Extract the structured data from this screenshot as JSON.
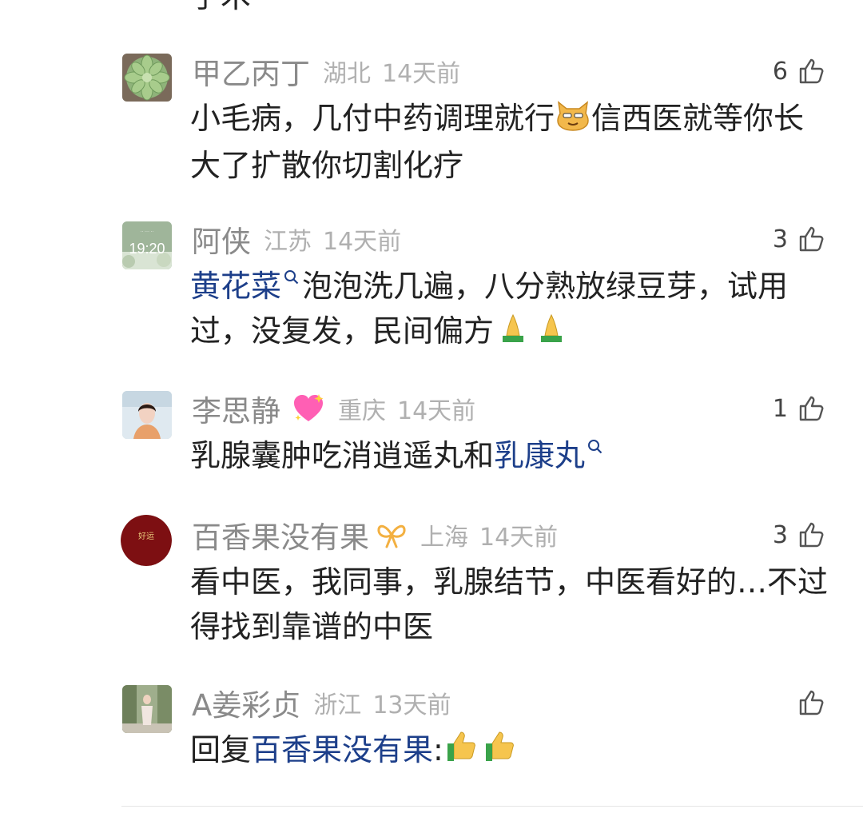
{
  "previous_tail": "手术",
  "comments": [
    {
      "name": "甲乙丙丁",
      "location": "湖北",
      "time": "14天前",
      "likes": "6",
      "text_parts": [
        "小毛病，几付中药调理就行",
        "信西医就等你长大了扩散你切割化疗"
      ],
      "emoji": "cat-emoji"
    },
    {
      "name": "阿侠",
      "location": "江苏",
      "time": "14天前",
      "likes": "3",
      "avatar_time": "19:20",
      "link": "黄花菜",
      "text_after_link": "泡泡洗几遍，八分熟放绿豆芽，试用过，没复发，民间偏方",
      "emoji": "pray-emoji"
    },
    {
      "name": "李思静",
      "location": "重庆",
      "time": "14天前",
      "likes": "1",
      "badge": "sparkling-heart-icon",
      "text_before_link": "乳腺囊肿吃消逍遥丸和",
      "link": "乳康丸"
    },
    {
      "name": "百香果没有果",
      "location": "上海",
      "time": "14天前",
      "likes": "3",
      "avatar_text": "好运",
      "badge": "ribbon-icon",
      "text": "看中医，我同事，乳腺结节，中医看好的…不过得找到靠谱的中医"
    },
    {
      "name": "A姜彩贞",
      "location": "浙江",
      "time": "13天前",
      "likes": "",
      "reply_prefix": "回复",
      "reply_to": "百香果没有果",
      "reply_colon": ":",
      "emoji": "thumbs-up-emoji"
    }
  ],
  "colors": {
    "link": "#1d3f8a",
    "meta": "#b0b0b0",
    "name": "#8a8a8a"
  }
}
